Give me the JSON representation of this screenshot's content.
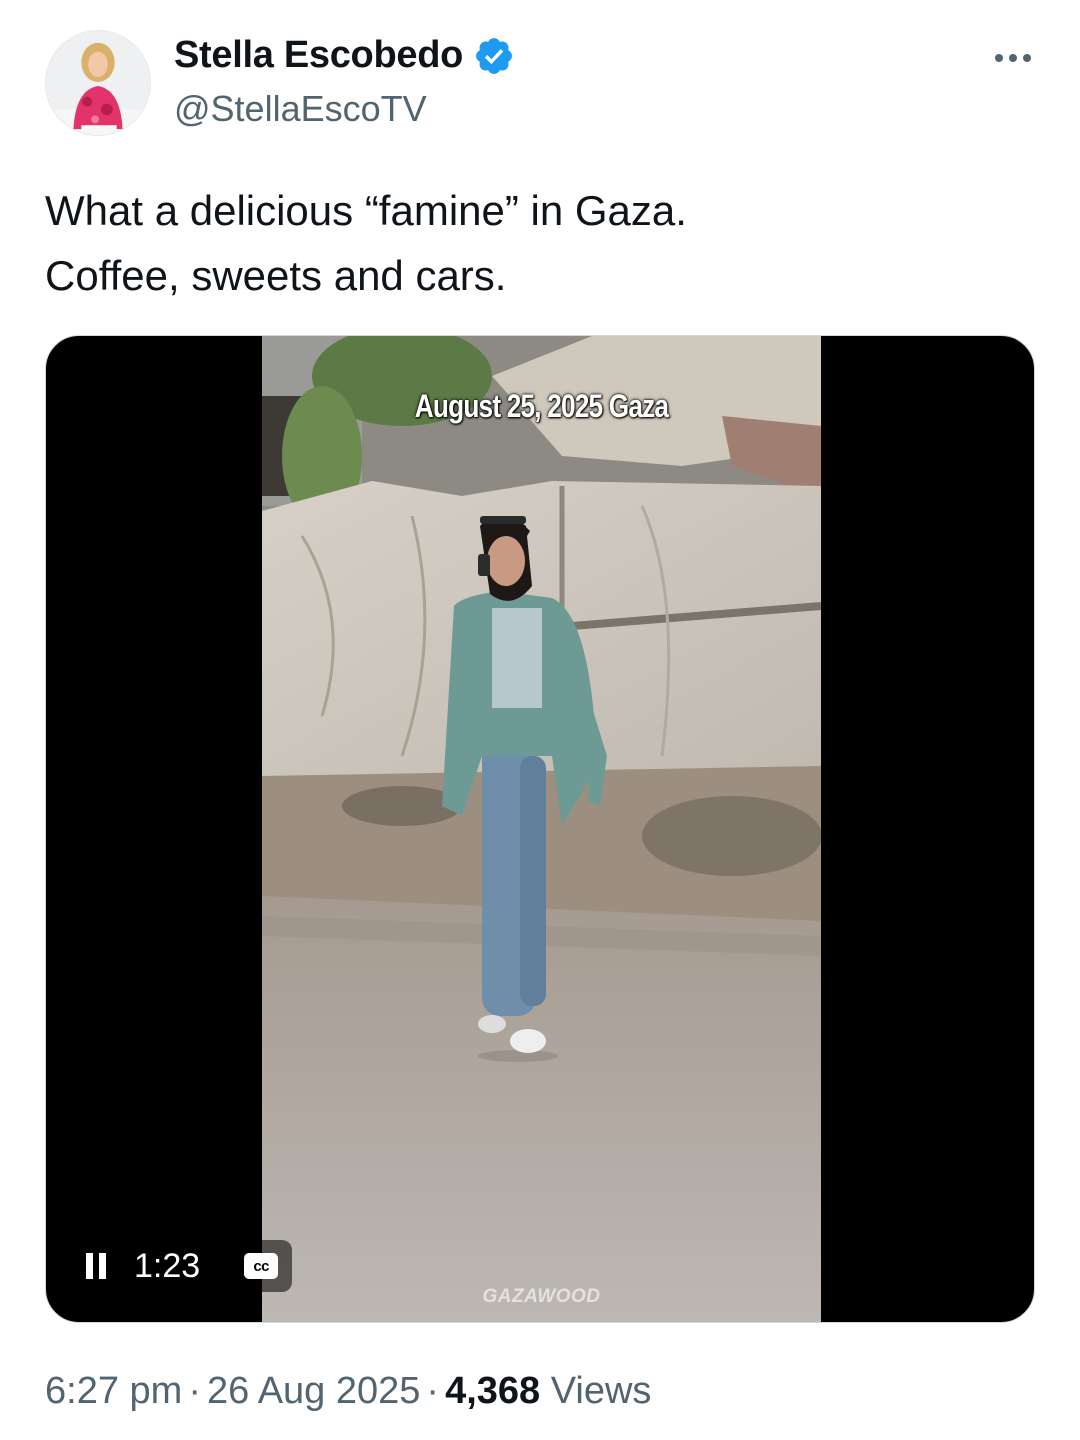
{
  "author": {
    "display_name": "Stella Escobedo",
    "handle": "@StellaEscoTV",
    "verified": true,
    "verified_color": "#1d9bf0"
  },
  "tweet": {
    "text_lines": [
      "What a delicious “famine” in Gaza.",
      "Coffee, sweets and cars."
    ]
  },
  "media": {
    "caption": "August 25, 2025 Gaza",
    "watermark": "GAZAWOOD",
    "playback_time": "1:23",
    "cc_label": "cc",
    "state": "playing"
  },
  "meta": {
    "time": "6:27 pm",
    "date": "26 Aug 2025",
    "separator": "·",
    "views_count": "4,368",
    "views_label": "Views"
  },
  "icons": {
    "more": "more-horizontal-icon",
    "verified": "verified-badge-icon",
    "pause": "pause-icon",
    "cc": "closed-captions-icon"
  }
}
